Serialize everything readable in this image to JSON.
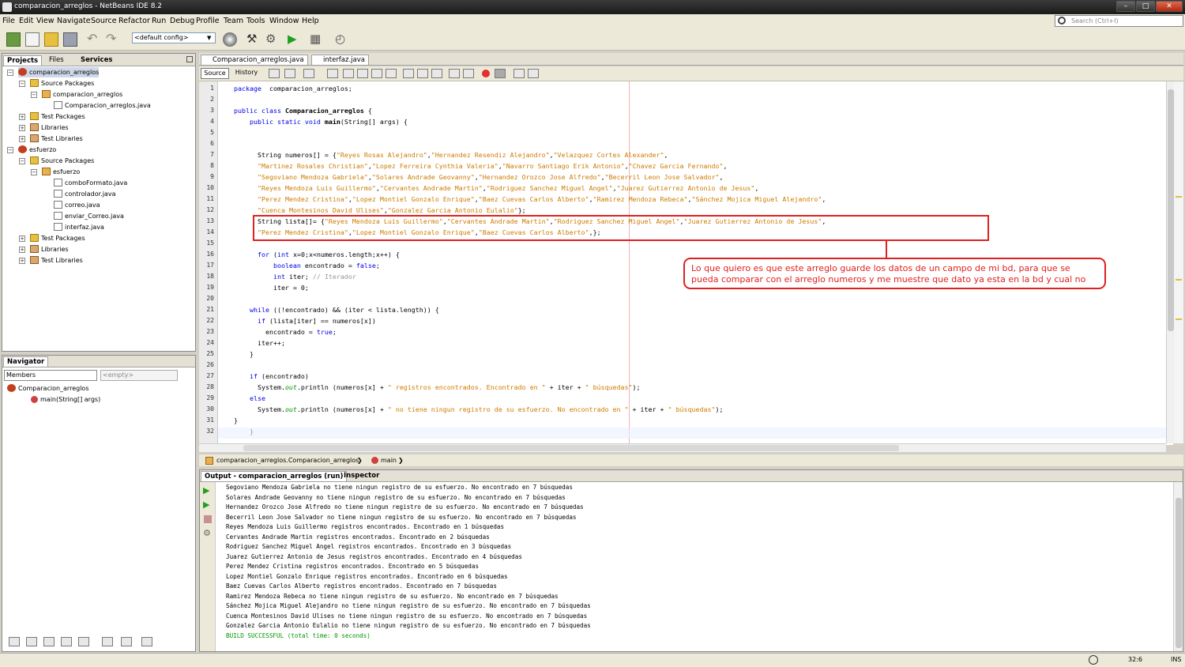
{
  "window": {
    "title": "comparacion_arreglos - NetBeans IDE 8.2",
    "minimize": "–",
    "maximize": "□",
    "close": "✕"
  },
  "menu": [
    "File",
    "Edit",
    "View",
    "Navigate",
    "Source",
    "Refactor",
    "Run",
    "Debug",
    "Profile",
    "Team",
    "Tools",
    "Window",
    "Help"
  ],
  "search_placeholder": "Search (Ctrl+I)",
  "config_value": "<default config>",
  "projects_tabs": [
    "Projects",
    "Files",
    "Services"
  ],
  "tree": [
    {
      "label": "comparacion_arreglos",
      "icon": "project-icon",
      "level": 0
    },
    {
      "label": "Source Packages",
      "icon": "folder-icon",
      "level": 1
    },
    {
      "label": "comparacion_arreglos",
      "icon": "package-icon",
      "level": 2
    },
    {
      "label": "Comparacion_arreglos.java",
      "icon": "java-file-icon",
      "level": 3
    },
    {
      "label": "Test Packages",
      "icon": "folder-icon",
      "level": 1
    },
    {
      "label": "Libraries",
      "icon": "library-icon",
      "level": 1
    },
    {
      "label": "Test Libraries",
      "icon": "library-icon",
      "level": 1
    },
    {
      "label": "esfuerzo",
      "icon": "project-icon",
      "level": 0
    },
    {
      "label": "Source Packages",
      "icon": "folder-icon",
      "level": 1
    },
    {
      "label": "esfuerzo",
      "icon": "package-icon",
      "level": 2
    },
    {
      "label": "comboFormato.java",
      "icon": "java-file-icon",
      "level": 3
    },
    {
      "label": "controlador.java",
      "icon": "java-file-icon",
      "level": 3
    },
    {
      "label": "correo.java",
      "icon": "java-file-icon",
      "level": 3
    },
    {
      "label": "enviar_Correo.java",
      "icon": "java-file-icon",
      "level": 3
    },
    {
      "label": "interfaz.java",
      "icon": "java-file-icon",
      "level": 3
    },
    {
      "label": "Test Packages",
      "icon": "folder-icon",
      "level": 1
    },
    {
      "label": "Libraries",
      "icon": "library-icon",
      "level": 1
    },
    {
      "label": "Test Libraries",
      "icon": "library-icon",
      "level": 1
    }
  ],
  "navigator": {
    "title": "Navigator",
    "members": "Members",
    "empty": "<empty>",
    "class": "Comparacion_arreglos",
    "method": "main(String[] args)"
  },
  "editor_tabs": [
    "Comparacion_arreglos.java",
    "interfaz.java"
  ],
  "editor_modes": {
    "source": "Source",
    "history": "History"
  },
  "code_lines": [
    [
      [
        "kw",
        "package"
      ],
      [
        "",
        "  comparacion_arreglos;"
      ]
    ],
    [],
    [
      [
        "kw",
        "public class"
      ],
      [
        "",
        " "
      ],
      [
        "fn",
        "Comparacion_arreglos"
      ],
      [
        "",
        " {"
      ]
    ],
    [
      [
        "",
        "    "
      ],
      [
        "kw",
        "public static void"
      ],
      [
        "",
        " "
      ],
      [
        "fn",
        "main"
      ],
      [
        "",
        "(String[] args) {"
      ]
    ],
    [],
    [],
    [
      [
        "",
        "      String numeros[] = {"
      ],
      [
        "str",
        "\"Reyes Rosas Alejandro\""
      ],
      [
        "",
        ","
      ],
      [
        "str",
        "\"Hernandez Resendiz Alejandro\""
      ],
      [
        "",
        ","
      ],
      [
        "str",
        "\"Velazquez Cortes Alexander\""
      ],
      [
        "",
        ","
      ]
    ],
    [
      [
        "",
        "      "
      ],
      [
        "str",
        "\"Martinez Rosales Christian\""
      ],
      [
        "",
        ","
      ],
      [
        "str",
        "\"Lopez Ferreira Cynthia Valeria\""
      ],
      [
        "",
        ","
      ],
      [
        "str",
        "\"Navarro Santiago Erik Antonio\""
      ],
      [
        "",
        ","
      ],
      [
        "str",
        "\"Chavez Garcia Fernando\""
      ],
      [
        "",
        ","
      ]
    ],
    [
      [
        "",
        "      "
      ],
      [
        "str",
        "\"Segoviano Mendoza Gabriela\""
      ],
      [
        "",
        ","
      ],
      [
        "str",
        "\"Solares Andrade Geovanny\""
      ],
      [
        "",
        ","
      ],
      [
        "str",
        "\"Hernandez Orozco Jose Alfredo\""
      ],
      [
        "",
        ","
      ],
      [
        "str",
        "\"Becerril Leon Jose Salvador\""
      ],
      [
        "",
        ","
      ]
    ],
    [
      [
        "",
        "      "
      ],
      [
        "str",
        "\"Reyes Mendoza Luis Guillermo\""
      ],
      [
        "",
        ","
      ],
      [
        "str",
        "\"Cervantes Andrade Martin\""
      ],
      [
        "",
        ","
      ],
      [
        "str",
        "\"Rodriguez Sanchez Miguel Angel\""
      ],
      [
        "",
        ","
      ],
      [
        "str",
        "\"Juarez Gutierrez Antonio de Jesus\""
      ],
      [
        "",
        ","
      ]
    ],
    [
      [
        "",
        "      "
      ],
      [
        "str",
        "\"Perez Mendez Cristina\""
      ],
      [
        "",
        ","
      ],
      [
        "str",
        "\"Lopez Montiel Gonzalo Enrique\""
      ],
      [
        "",
        ","
      ],
      [
        "str",
        "\"Baez Cuevas Carlos Alberto\""
      ],
      [
        "",
        ","
      ],
      [
        "str",
        "\"Ramirez Mendoza Rebeca\""
      ],
      [
        "",
        ","
      ],
      [
        "str",
        "\"Sánchez Mojica Miguel Alejandro\""
      ],
      [
        "",
        ","
      ]
    ],
    [
      [
        "",
        "      "
      ],
      [
        "str",
        "\"Cuenca Montesinos David Ulises\""
      ],
      [
        "",
        ","
      ],
      [
        "str",
        "\"Gonzalez Garcia Antonio Eulalio\""
      ],
      [
        "",
        "};"
      ]
    ],
    [
      [
        "",
        "      String lista[]= {"
      ],
      [
        "str",
        "\"Reyes Mendoza Luis Guillermo\""
      ],
      [
        "",
        ","
      ],
      [
        "str",
        "\"Cervantes Andrade Martin\""
      ],
      [
        "",
        ","
      ],
      [
        "str",
        "\"Rodriguez Sanchez Miguel Angel\""
      ],
      [
        "",
        ","
      ],
      [
        "str",
        "\"Juarez Gutierrez Antonio de Jesus\""
      ],
      [
        "",
        ","
      ]
    ],
    [
      [
        "",
        "      "
      ],
      [
        "str",
        "\"Perez Mendez Cristina\""
      ],
      [
        "",
        ","
      ],
      [
        "str",
        "\"Lopez Montiel Gonzalo Enrique\""
      ],
      [
        "",
        ","
      ],
      [
        "str",
        "\"Baez Cuevas Carlos Alberto\""
      ],
      [
        "",
        ",};"
      ]
    ],
    [],
    [
      [
        "",
        "      "
      ],
      [
        "kw",
        "for"
      ],
      [
        "",
        " ("
      ],
      [
        "kw",
        "int"
      ],
      [
        "",
        " x=0;x<numeros.length;x++) {"
      ]
    ],
    [
      [
        "",
        "          "
      ],
      [
        "kw",
        "boolean"
      ],
      [
        "",
        " encontrado = "
      ],
      [
        "kw",
        "false"
      ],
      [
        "",
        ";"
      ]
    ],
    [
      [
        "",
        "          "
      ],
      [
        "kw",
        "int"
      ],
      [
        "",
        " iter; "
      ],
      [
        "cmt",
        "// Iterador"
      ]
    ],
    [
      [
        "",
        "          iter = 0;"
      ]
    ],
    [],
    [
      [
        "",
        "    "
      ],
      [
        "kw",
        "while"
      ],
      [
        "",
        " ((!encontrado) && (iter < lista.length)) {"
      ]
    ],
    [
      [
        "",
        "      "
      ],
      [
        "kw",
        "if"
      ],
      [
        "",
        " (lista[iter] == numeros[x])"
      ]
    ],
    [
      [
        "",
        "        encontrado = "
      ],
      [
        "kw",
        "true"
      ],
      [
        "",
        ";"
      ]
    ],
    [
      [
        "",
        "      iter++;"
      ]
    ],
    [
      [
        "",
        "    }"
      ]
    ],
    [],
    [
      [
        "",
        "    "
      ],
      [
        "kw",
        "if"
      ],
      [
        "",
        " (encontrado)"
      ]
    ],
    [
      [
        "",
        "      System."
      ],
      [
        "sfld",
        "out"
      ],
      [
        "",
        ".println (numeros[x] + "
      ],
      [
        "str",
        "\" registros encontrados. Encontrado en \""
      ],
      [
        "",
        " + iter + "
      ],
      [
        "str",
        "\" búsquedas\""
      ],
      [
        "",
        ");"
      ]
    ],
    [
      [
        "",
        "    "
      ],
      [
        "kw",
        "else"
      ]
    ],
    [
      [
        "",
        "      System."
      ],
      [
        "sfld",
        "out"
      ],
      [
        "",
        ".println (numeros[x] + "
      ],
      [
        "str",
        "\" no tiene ningun registro de su esfuerzo. No encontrado en \""
      ],
      [
        "",
        " + iter + "
      ],
      [
        "str",
        "\" búsquedas\""
      ],
      [
        "",
        ");"
      ]
    ],
    [
      [
        "",
        "}"
      ]
    ],
    [
      [
        "",
        "    }"
      ]
    ]
  ],
  "breadcrumb": {
    "class": "comparacion_arreglos.Comparacion_arreglos",
    "method": "main"
  },
  "output_tabs": [
    "Output - comparacion_arreglos (run)",
    "Inspector"
  ],
  "output_lines": [
    "Segoviano Mendoza Gabriela no tiene ningun registro de su esfuerzo. No encontrado en 7 búsquedas",
    "Solares Andrade Geovanny no tiene ningun registro de su esfuerzo. No encontrado en 7 búsquedas",
    "Hernandez Orozco Jose Alfredo no tiene ningun registro de su esfuerzo. No encontrado en 7 búsquedas",
    "Becerril Leon Jose Salvador no tiene ningun registro de su esfuerzo. No encontrado en 7 búsquedas",
    "Reyes Mendoza Luis Guillermo registros encontrados. Encontrado en 1 búsquedas",
    "Cervantes Andrade Martin registros encontrados. Encontrado en 2 búsquedas",
    "Rodriguez Sanchez Miguel Angel registros encontrados. Encontrado en 3 búsquedas",
    "Juarez Gutierrez Antonio de Jesus registros encontrados. Encontrado en 4 búsquedas",
    "Perez Mendez Cristina registros encontrados. Encontrado en 5 búsquedas",
    "Lopez Montiel Gonzalo Enrique registros encontrados. Encontrado en 6 búsquedas",
    "Baez Cuevas Carlos Alberto registros encontrados. Encontrado en 7 búsquedas",
    "Ramirez Mendoza Rebeca no tiene ningun registro de su esfuerzo. No encontrado en 7 búsquedas",
    "Sánchez Mojica Miguel Alejandro no tiene ningun registro de su esfuerzo. No encontrado en 7 búsquedas",
    "Cuenca Montesinos David Ulises no tiene ningun registro de su esfuerzo. No encontrado en 7 búsquedas",
    "Gonzalez Garcia Antonio Eulalio no tiene ningun registro de su esfuerzo. No encontrado en 7 búsquedas"
  ],
  "build_result": "BUILD SUCCESSFUL (total time: 0 seconds)",
  "callout_text": "Lo que quiero es que este arreglo guarde los datos de un campo de mi bd, para que se pueda comparar con el arreglo numeros y me muestre que dato ya esta en la bd y cual no",
  "status": {
    "position": "32:6",
    "mode": "INS"
  },
  "colors": {
    "keyword": "#0000e6",
    "string": "#ce7b00",
    "annotation": "#e02020",
    "build": "#009900"
  }
}
